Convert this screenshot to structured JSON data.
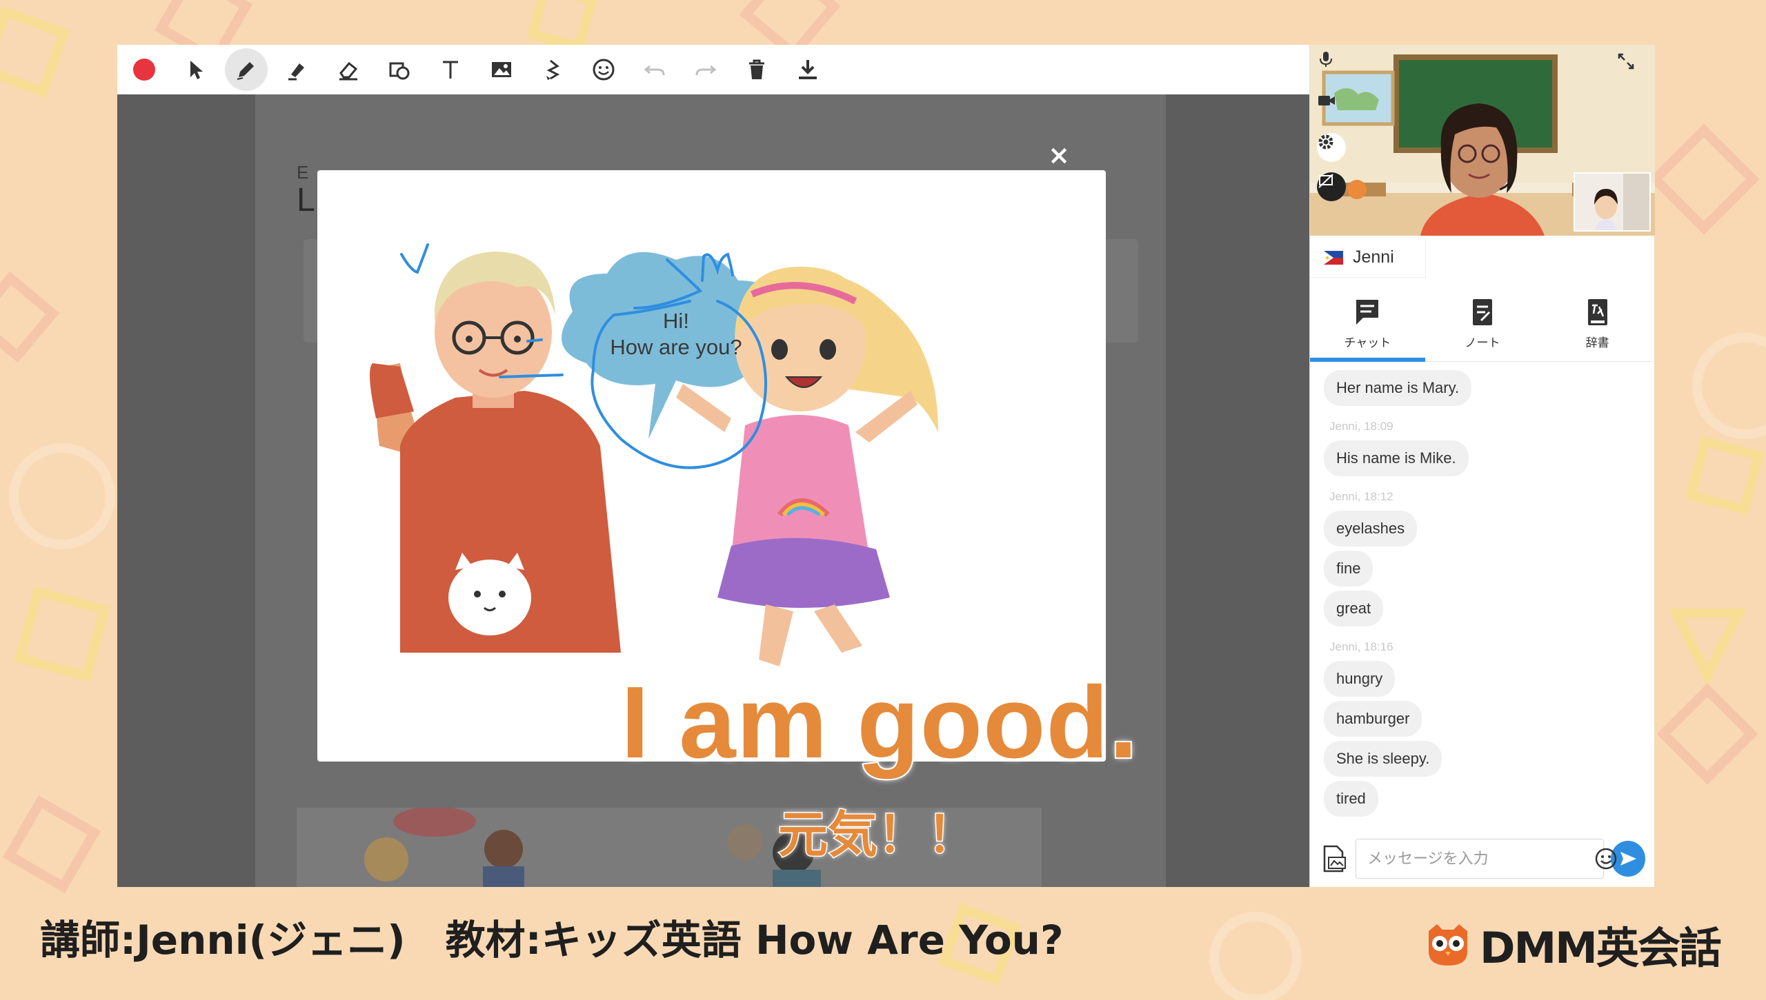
{
  "toolbar": {
    "tools": [
      {
        "icon": "record-icon",
        "label": "record"
      },
      {
        "icon": "pointer-icon",
        "label": "select"
      },
      {
        "icon": "pen-icon",
        "label": "pen",
        "active": true
      },
      {
        "icon": "highlighter-icon",
        "label": "marker"
      },
      {
        "icon": "eraser-icon",
        "label": "eraser"
      },
      {
        "icon": "shape-icon",
        "label": "shapes"
      },
      {
        "icon": "text-icon",
        "label": "text"
      },
      {
        "icon": "image-icon",
        "label": "image"
      },
      {
        "icon": "laser-pointer-icon",
        "label": "laser"
      },
      {
        "icon": "emoji-icon",
        "label": "sticker"
      },
      {
        "icon": "undo-icon",
        "label": "undo",
        "disabled": true
      },
      {
        "icon": "redo-icon",
        "label": "redo",
        "disabled": true
      },
      {
        "icon": "trash-icon",
        "label": "delete"
      },
      {
        "icon": "download-icon",
        "label": "download"
      }
    ]
  },
  "board": {
    "page_fragment_small": "E",
    "page_fragment_large": "L"
  },
  "modal": {
    "close_label": "×",
    "bubble_line1": "Hi!",
    "bubble_line2": "How are you?"
  },
  "video": {
    "teacher_name": "Jenni",
    "flag_icon": "philippines-flag-icon"
  },
  "tabs": [
    {
      "label": "チャット",
      "icon": "chat-icon",
      "active": true
    },
    {
      "label": "ノート",
      "icon": "note-icon",
      "active": false
    },
    {
      "label": "辞書",
      "icon": "dictionary-icon",
      "active": false
    }
  ],
  "chat": {
    "messages_top": [
      "Her name is Mary."
    ],
    "groups": [
      {
        "meta": "Jenni, 18:09",
        "messages": [
          "His name is Mike."
        ]
      },
      {
        "meta": "Jenni, 18:12",
        "messages": [
          "eyelashes",
          "fine",
          "great"
        ]
      },
      {
        "meta": "Jenni, 18:16",
        "messages": [
          "hungry",
          "hamburger",
          "She is sleepy.",
          "tired"
        ]
      }
    ]
  },
  "composer": {
    "placeholder": "メッセージを入力"
  },
  "captions": {
    "english": "I am good.",
    "japanese": "元気！！"
  },
  "footer": {
    "info": "講師:Jenni(ジェニ)　教材:キッズ英語 How Are You?",
    "brand": "DMM英会話"
  },
  "colors": {
    "accent": "#2f8ee0",
    "caption_orange": "#e58a3a",
    "record_red": "#e8343e",
    "background": "#f8d9b4"
  }
}
